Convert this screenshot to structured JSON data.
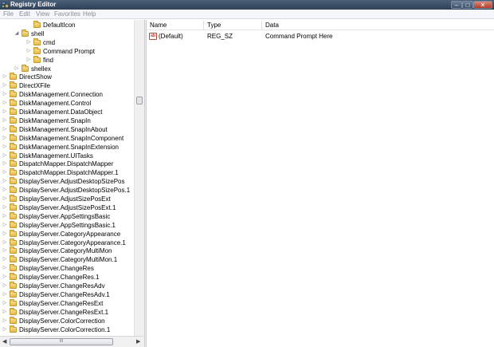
{
  "window": {
    "title": "Registry Editor"
  },
  "window_buttons": {
    "minimize": "–",
    "maximize": "□",
    "close": "✕"
  },
  "menu": [
    "File",
    "Edit",
    "View",
    "Favorites",
    "Help"
  ],
  "tree": [
    {
      "label": "DefaultIcon",
      "level": 3,
      "twisty": ""
    },
    {
      "label": "shell",
      "level": 2,
      "twisty": "◢"
    },
    {
      "label": "cmd",
      "level": 3,
      "twisty": "▷"
    },
    {
      "label": "Command Prompt",
      "level": 3,
      "twisty": "▷"
    },
    {
      "label": "find",
      "level": 3,
      "twisty": "▷"
    },
    {
      "label": "shellex",
      "level": 2,
      "twisty": "▷"
    },
    {
      "label": "DirectShow",
      "level": 1,
      "twisty": "▷"
    },
    {
      "label": "DirectXFile",
      "level": 1,
      "twisty": "▷"
    },
    {
      "label": "DiskManagement.Connection",
      "level": 1,
      "twisty": "▷"
    },
    {
      "label": "DiskManagement.Control",
      "level": 1,
      "twisty": "▷"
    },
    {
      "label": "DiskManagement.DataObject",
      "level": 1,
      "twisty": "▷"
    },
    {
      "label": "DiskManagement.SnapIn",
      "level": 1,
      "twisty": "▷"
    },
    {
      "label": "DiskManagement.SnapInAbout",
      "level": 1,
      "twisty": "▷"
    },
    {
      "label": "DiskManagement.SnapInComponent",
      "level": 1,
      "twisty": "▷"
    },
    {
      "label": "DiskManagement.SnapInExtension",
      "level": 1,
      "twisty": "▷"
    },
    {
      "label": "DiskManagement.UITasks",
      "level": 1,
      "twisty": "▷"
    },
    {
      "label": "DispatchMapper.DispatchMapper",
      "level": 1,
      "twisty": "▷"
    },
    {
      "label": "DispatchMapper.DispatchMapper.1",
      "level": 1,
      "twisty": "▷"
    },
    {
      "label": "DisplayServer.AdjustDesktopSizePos",
      "level": 1,
      "twisty": "▷"
    },
    {
      "label": "DisplayServer.AdjustDesktopSizePos.1",
      "level": 1,
      "twisty": "▷"
    },
    {
      "label": "DisplayServer.AdjustSizePosExt",
      "level": 1,
      "twisty": "▷"
    },
    {
      "label": "DisplayServer.AdjustSizePosExt.1",
      "level": 1,
      "twisty": "▷"
    },
    {
      "label": "DisplayServer.AppSettingsBasic",
      "level": 1,
      "twisty": "▷"
    },
    {
      "label": "DisplayServer.AppSettingsBasic.1",
      "level": 1,
      "twisty": "▷"
    },
    {
      "label": "DisplayServer.CategoryAppearance",
      "level": 1,
      "twisty": "▷"
    },
    {
      "label": "DisplayServer.CategoryAppearance.1",
      "level": 1,
      "twisty": "▷"
    },
    {
      "label": "DisplayServer.CategoryMultiMon",
      "level": 1,
      "twisty": "▷"
    },
    {
      "label": "DisplayServer.CategoryMultiMon.1",
      "level": 1,
      "twisty": "▷"
    },
    {
      "label": "DisplayServer.ChangeRes",
      "level": 1,
      "twisty": "▷"
    },
    {
      "label": "DisplayServer.ChangeRes.1",
      "level": 1,
      "twisty": "▷"
    },
    {
      "label": "DisplayServer.ChangeResAdv",
      "level": 1,
      "twisty": "▷"
    },
    {
      "label": "DisplayServer.ChangeResAdv.1",
      "level": 1,
      "twisty": "▷"
    },
    {
      "label": "DisplayServer.ChangeResExt",
      "level": 1,
      "twisty": "▷"
    },
    {
      "label": "DisplayServer.ChangeResExt.1",
      "level": 1,
      "twisty": "▷"
    },
    {
      "label": "DisplayServer.ColorCorrection",
      "level": 1,
      "twisty": "▷"
    },
    {
      "label": "DisplayServer.ColorCorrection.1",
      "level": 1,
      "twisty": "▷"
    }
  ],
  "tree_scrollbar": {
    "left_arrow": "◀",
    "right_arrow": "▶",
    "grip": "III"
  },
  "list": {
    "columns": [
      "Name",
      "Type",
      "Data"
    ],
    "rows": [
      {
        "icon": "string-value-icon",
        "icon_text": "ab",
        "name": "(Default)",
        "type": "REG_SZ",
        "data": "Command Prompt Here"
      }
    ]
  },
  "colors": {
    "titlebar": "#3b4e66",
    "folder": "#e9c25c",
    "menu_text": "#8a8f97"
  }
}
